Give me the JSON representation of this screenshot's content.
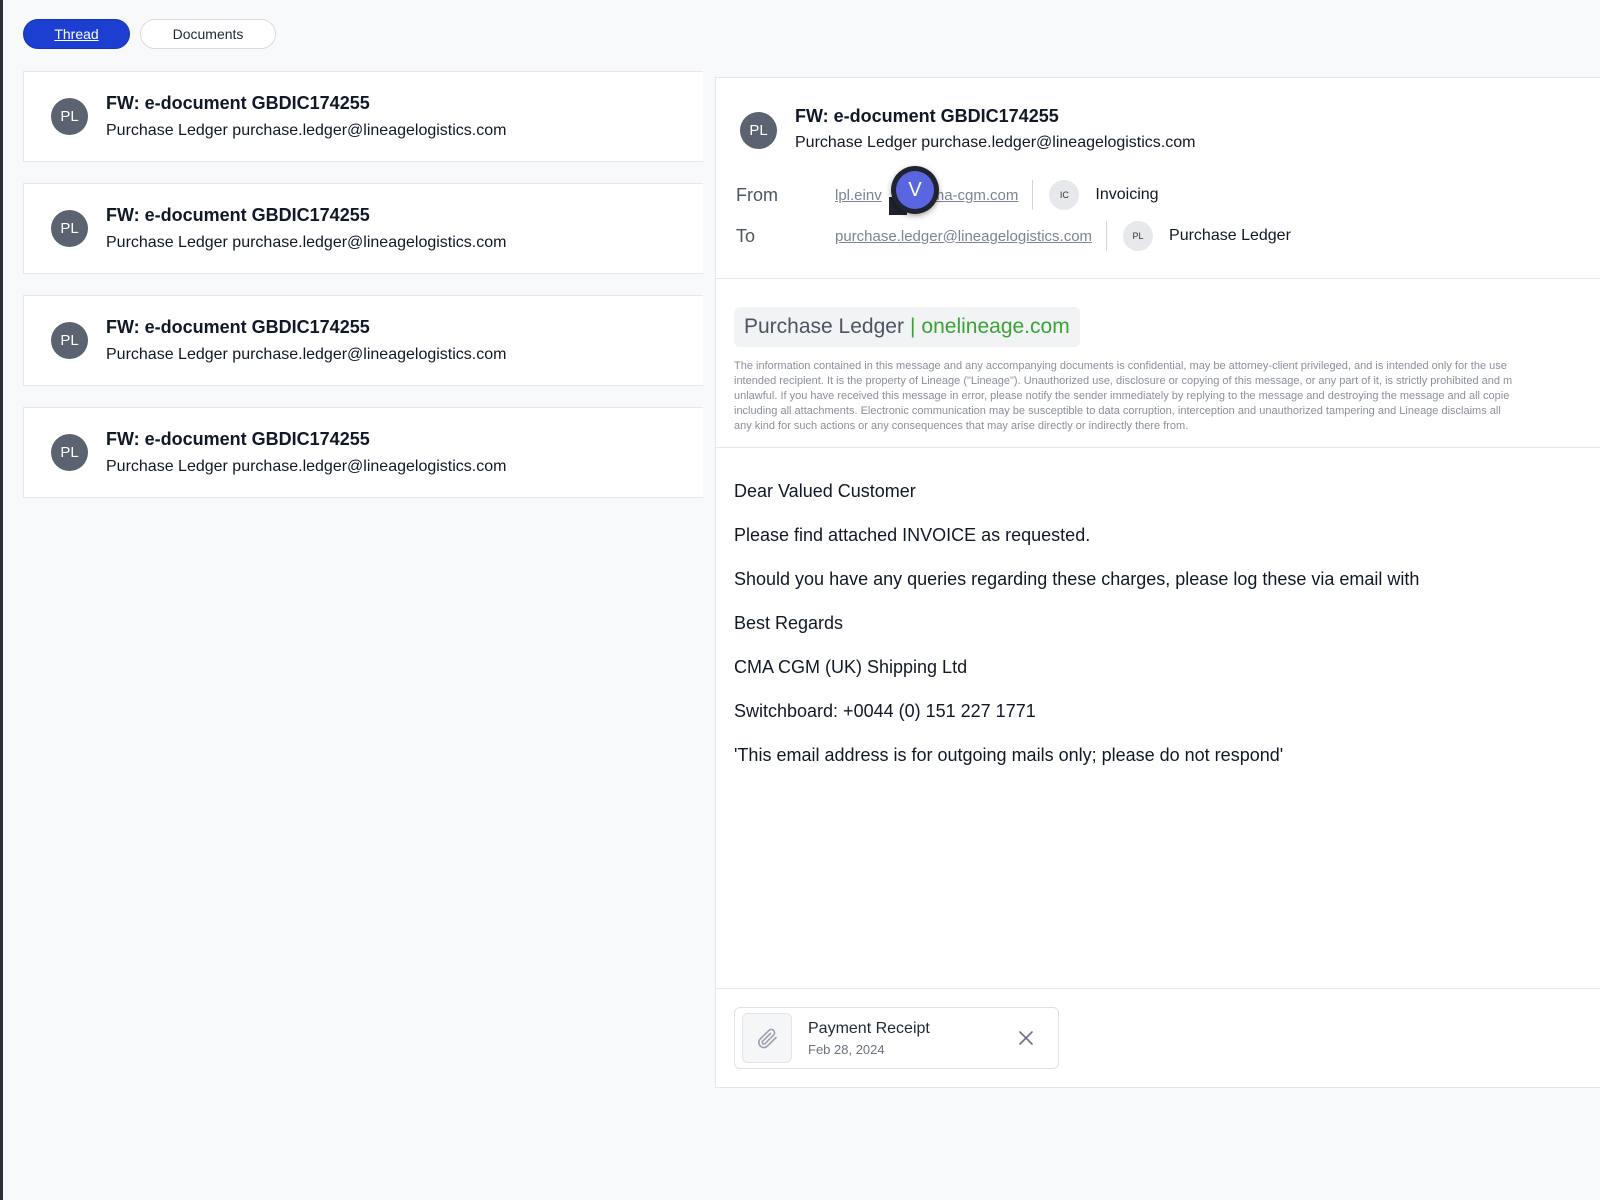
{
  "tabs": [
    {
      "label": "Thread",
      "active": true
    },
    {
      "label": "Documents",
      "active": false
    }
  ],
  "threads": [
    {
      "avatar": "PL",
      "subject": "FW: e-document GBDIC174255",
      "sender": "Purchase Ledger purchase.ledger@lineagelogistics.com"
    },
    {
      "avatar": "PL",
      "subject": "FW: e-document GBDIC174255",
      "sender": "Purchase Ledger purchase.ledger@lineagelogistics.com"
    },
    {
      "avatar": "PL",
      "subject": "FW: e-document GBDIC174255",
      "sender": "Purchase Ledger purchase.ledger@lineagelogistics.com"
    },
    {
      "avatar": "PL",
      "subject": "FW: e-document GBDIC174255",
      "sender": "Purchase Ledger purchase.ledger@lineagelogistics.com"
    }
  ],
  "message": {
    "avatar": "PL",
    "subject": "FW: e-document GBDIC174255",
    "sender": "Purchase Ledger purchase.ledger@lineagelogistics.com",
    "from": {
      "label": "From",
      "email_left": "lpl.einv",
      "email_right": "ma-cgm.com",
      "initials": "IC",
      "name": "Invoicing"
    },
    "to": {
      "label": "To",
      "email": "purchase.ledger@lineagelogistics.com",
      "initials": "PL",
      "name": "Purchase Ledger"
    },
    "cursor_badge": "V",
    "signature": {
      "name": "Purchase Ledger",
      "separator": "|",
      "domain": "onelineage.com"
    },
    "disclaimer": [
      "The information contained in this message and any accompanying documents is confidential, may be attorney-client privileged, and is intended only for the use",
      "intended recipient. It is the property of Lineage (\"Lineage\"). Unauthorized use, disclosure or copying of this message, or any part of it, is strictly prohibited and m",
      "unlawful. If you have received this message in error, please notify the sender immediately by replying to the message and destroying the message and all copie",
      "including all attachments. Electronic communication may be susceptible to data corruption, interception and unauthorized tampering and Lineage disclaims all",
      "any kind for such actions or any consequences that may arise directly or indirectly there from."
    ],
    "body": [
      "Dear Valued Customer",
      "Please find attached INVOICE as requested.",
      "Should you have any queries regarding these charges, please log these via email with",
      "Best Regards",
      "CMA CGM (UK) Shipping Ltd",
      "Switchboard: +0044 (0) 151 227 1771",
      "'This email address is for outgoing mails only; please do not respond'"
    ],
    "attachment": {
      "icon": "paperclip-icon",
      "name": "Payment Receipt",
      "date": "Feb 28, 2024"
    }
  },
  "colors": {
    "accent": "#1d3fd1",
    "avatar": "#5b6270",
    "signature_green": "#3aa335",
    "cursor": "#5966e0"
  }
}
